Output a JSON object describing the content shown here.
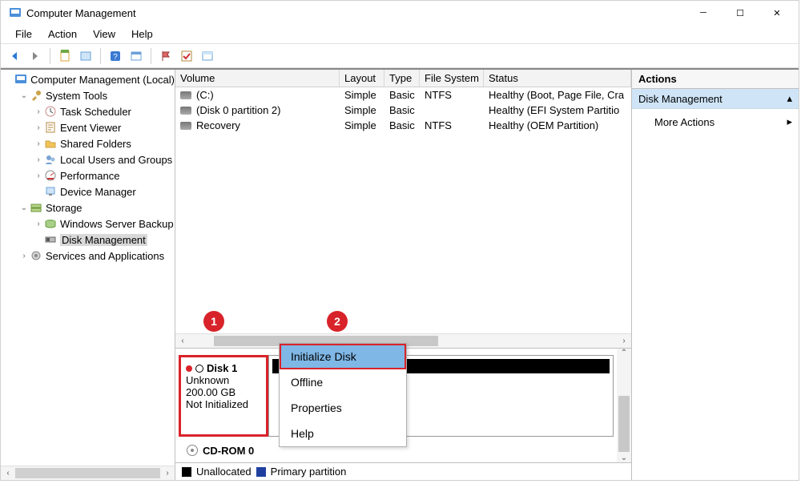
{
  "title": "Computer Management",
  "menubar": [
    "File",
    "Action",
    "View",
    "Help"
  ],
  "tree": [
    {
      "indent": 0,
      "expander": "",
      "icon": "mmc",
      "label": "Computer Management (Local)"
    },
    {
      "indent": 1,
      "expander": "v",
      "icon": "tools",
      "label": "System Tools"
    },
    {
      "indent": 2,
      "expander": ">",
      "icon": "sched",
      "label": "Task Scheduler"
    },
    {
      "indent": 2,
      "expander": ">",
      "icon": "event",
      "label": "Event Viewer"
    },
    {
      "indent": 2,
      "expander": ">",
      "icon": "folder",
      "label": "Shared Folders"
    },
    {
      "indent": 2,
      "expander": ">",
      "icon": "users",
      "label": "Local Users and Groups"
    },
    {
      "indent": 2,
      "expander": ">",
      "icon": "perf",
      "label": "Performance"
    },
    {
      "indent": 2,
      "expander": "",
      "icon": "devmgr",
      "label": "Device Manager"
    },
    {
      "indent": 1,
      "expander": "v",
      "icon": "storage",
      "label": "Storage"
    },
    {
      "indent": 2,
      "expander": ">",
      "icon": "backup",
      "label": "Windows Server Backup"
    },
    {
      "indent": 2,
      "expander": "",
      "icon": "diskmgmt",
      "label": "Disk Management",
      "selected": true
    },
    {
      "indent": 1,
      "expander": ">",
      "icon": "services",
      "label": "Services and Applications"
    }
  ],
  "volumes": {
    "headers": {
      "volume": "Volume",
      "layout": "Layout",
      "type": "Type",
      "fs": "File System",
      "status": "Status"
    },
    "rows": [
      {
        "name": "(C:)",
        "layout": "Simple",
        "type": "Basic",
        "fs": "NTFS",
        "status": "Healthy (Boot, Page File, Cra"
      },
      {
        "name": "(Disk 0 partition 2)",
        "layout": "Simple",
        "type": "Basic",
        "fs": "",
        "status": "Healthy (EFI System Partitio"
      },
      {
        "name": "Recovery",
        "layout": "Simple",
        "type": "Basic",
        "fs": "NTFS",
        "status": "Healthy (OEM Partition)"
      }
    ]
  },
  "disk1": {
    "name": "Disk 1",
    "line1": "Unknown",
    "line2": "200.00 GB",
    "line3": "Not Initialized"
  },
  "cdrom": "CD-ROM 0",
  "legend": {
    "unalloc": "Unallocated",
    "primary": "Primary partition"
  },
  "actions": {
    "title": "Actions",
    "node": "Disk Management",
    "more": "More Actions"
  },
  "context_menu": [
    "Initialize Disk",
    "Offline",
    "Properties",
    "Help"
  ],
  "annotations": {
    "a1": "1",
    "a2": "2"
  }
}
